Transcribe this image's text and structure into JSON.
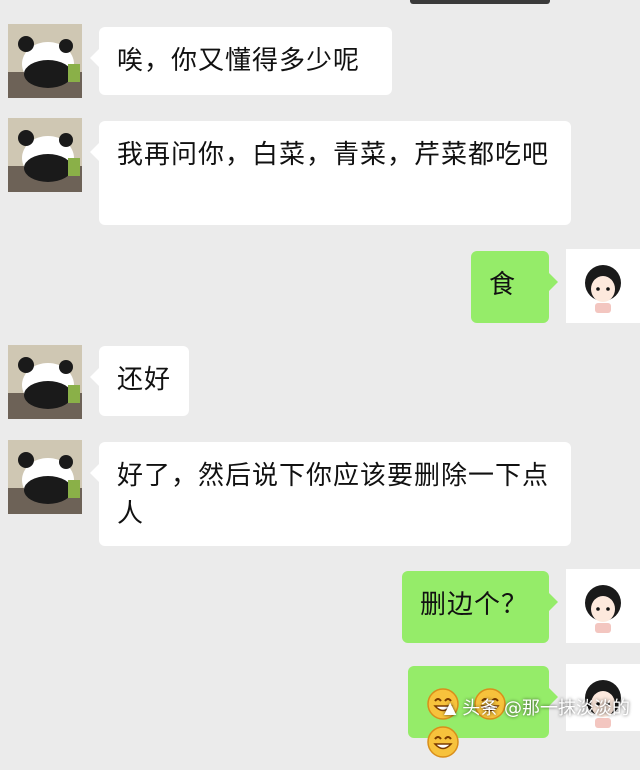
{
  "messages": [
    {
      "side": "left",
      "text": "唉，你又懂得多少呢"
    },
    {
      "side": "left",
      "text": "我再问你，白菜，青菜，芹菜都吃吧"
    },
    {
      "side": "right",
      "text": "食"
    },
    {
      "side": "left",
      "text": "还好"
    },
    {
      "side": "left",
      "text": "好了，然后说下你应该要删除一下点人"
    },
    {
      "side": "right",
      "text": "删边个？"
    },
    {
      "side": "right",
      "text": "",
      "emojis": [
        "grin-emoji",
        "grin-emoji",
        "grin-emoji"
      ]
    }
  ],
  "watermark": {
    "text": "头条 @那一抹淡淡的"
  },
  "colors": {
    "background": "#ebebeb",
    "bubble_left": "#ffffff",
    "bubble_right": "#95ec69"
  },
  "avatars": {
    "left": "panda-avatar",
    "right": "girl-avatar"
  }
}
